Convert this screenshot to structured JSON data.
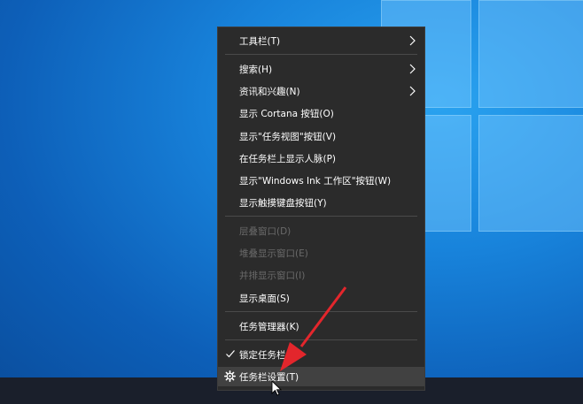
{
  "colors": {
    "menu_bg": "#2b2b2b",
    "menu_hover": "#414141",
    "text": "#ffffff",
    "text_disabled": "#6a6a6a",
    "arrow_annotation": "#e3262c"
  },
  "menu": {
    "toolbar": "工具栏(T)",
    "search": "搜索(H)",
    "news": "资讯和兴趣(N)",
    "cortana": "显示 Cortana 按钮(O)",
    "taskview": "显示\"任务视图\"按钮(V)",
    "people": "在任务栏上显示人脉(P)",
    "ink": "显示\"Windows Ink 工作区\"按钮(W)",
    "keyboard": "显示触摸键盘按钮(Y)",
    "cascade": "层叠窗口(D)",
    "stacked": "堆叠显示窗口(E)",
    "sidebyside": "并排显示窗口(I)",
    "desktop": "显示桌面(S)",
    "taskmgr": "任务管理器(K)",
    "lock": "锁定任务栏(L)",
    "settings": "任务栏设置(T)"
  },
  "icons": {
    "submenu": "chevron-right-icon",
    "checked": "checkmark-icon",
    "settings": "gear-icon",
    "pointer": "mouse-pointer-icon"
  }
}
